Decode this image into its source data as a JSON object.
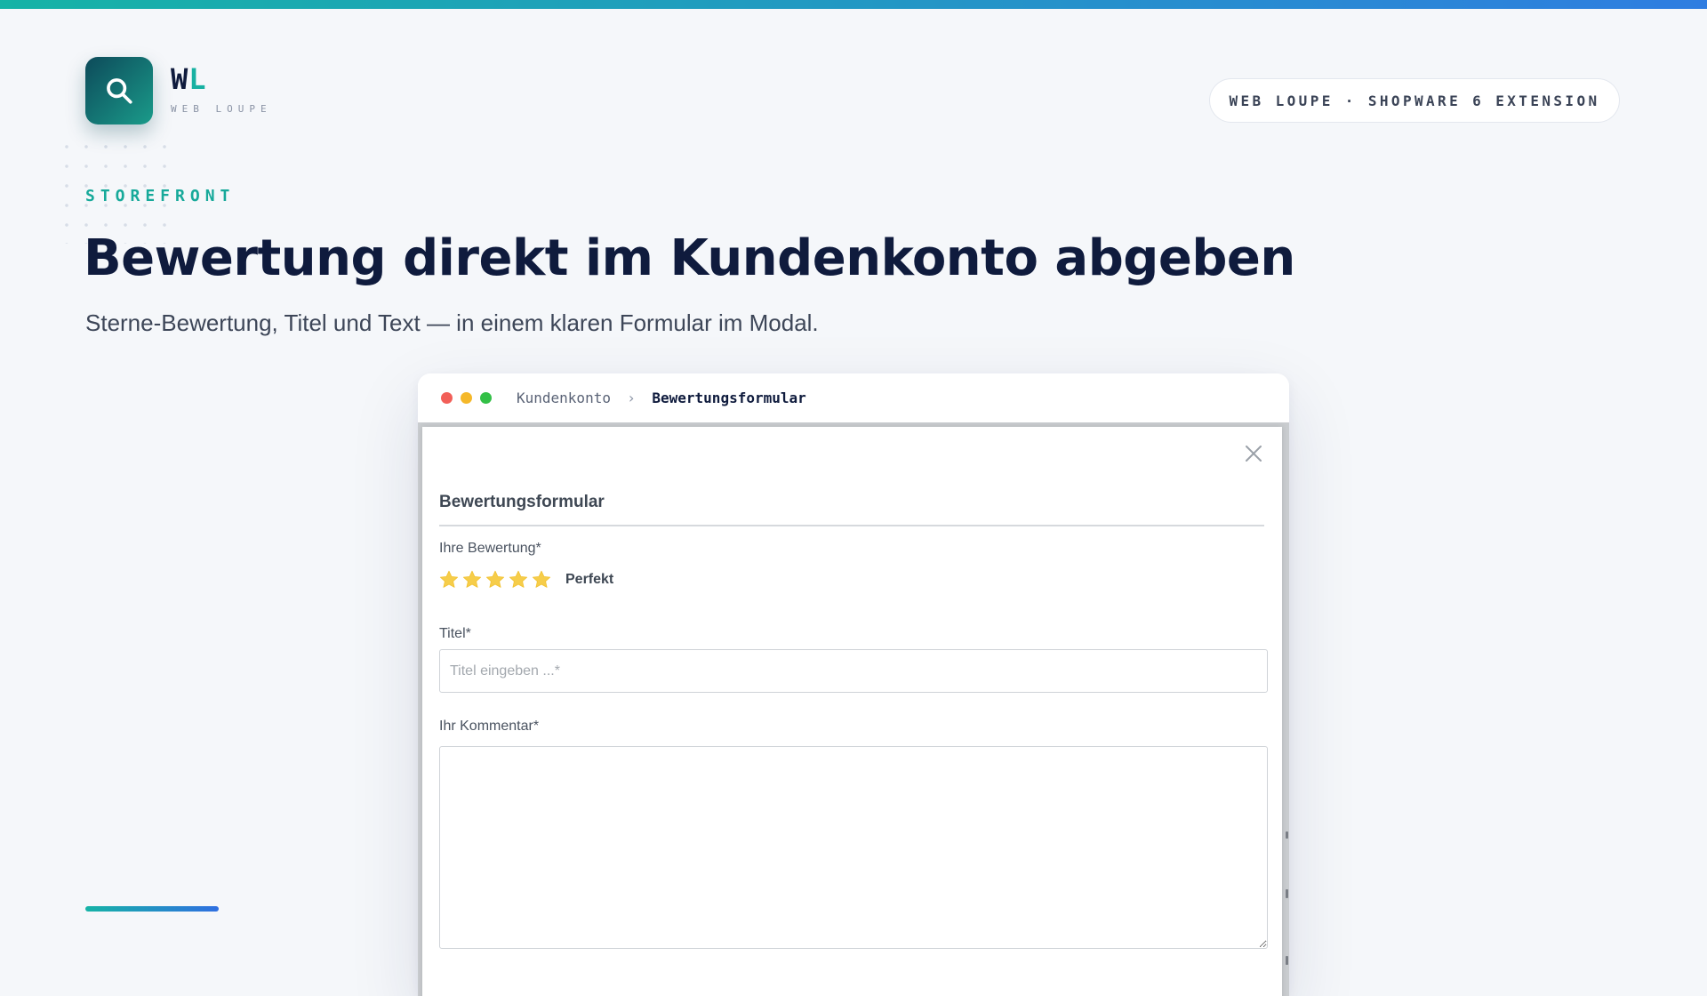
{
  "brand": {
    "mark_primary": "W",
    "mark_accent": "L",
    "subtitle": "WEB LOUPE",
    "logo_icon": "search-icon"
  },
  "badge": {
    "text": "WEB LOUPE · SHOPWARE 6 EXTENSION"
  },
  "hero": {
    "eyebrow": "STOREFRONT",
    "title": "Bewertung direkt im Kundenkonto abgeben",
    "subtitle": "Sterne-Bewertung, Titel und Text — in einem klaren Formular im Modal."
  },
  "browser": {
    "breadcrumb": [
      "Kundenkonto",
      "Bewertungsformular"
    ],
    "breadcrumb_separator": "›"
  },
  "modal": {
    "title": "Bewertungsformular",
    "close_icon": "close-icon",
    "rating_label": "Ihre Bewertung*",
    "rating_value": 5,
    "rating_max": 5,
    "rating_text": "Perfekt",
    "title_label": "Titel*",
    "title_placeholder": "Titel eingeben ...*",
    "title_value": "",
    "comment_label": "Ihr Kommentar*",
    "comment_value": ""
  },
  "colors": {
    "accent_teal": "#17b1a2",
    "accent_blue": "#2f7de1",
    "star": "#f6cd4a",
    "heading": "#0f1b3d"
  }
}
